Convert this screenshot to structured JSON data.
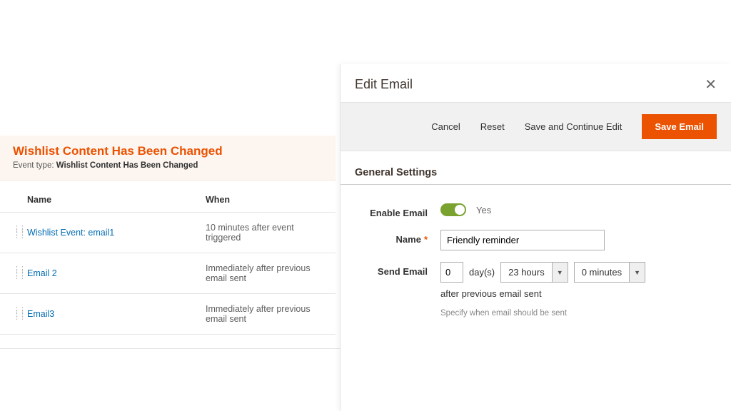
{
  "section": {
    "title": "Wishlist Content Has Been Changed",
    "event_type_label": "Event type:",
    "event_type_value": "Wishlist Content Has Been Changed"
  },
  "columns": {
    "name": "Name",
    "when": "When"
  },
  "rows": [
    {
      "name": "Wishlist Event: email1",
      "when": "10 minutes after event triggered"
    },
    {
      "name": "Email 2",
      "when": "Immediately after previous email sent"
    },
    {
      "name": "Email3",
      "when": "Immediately after previous email sent"
    }
  ],
  "modal": {
    "title": "Edit Email",
    "actions": {
      "cancel": "Cancel",
      "reset": "Reset",
      "save_continue": "Save and Continue Edit",
      "save": "Save Email"
    },
    "general_settings": "General Settings",
    "fields": {
      "enable_email_label": "Enable Email",
      "enable_email_value": "Yes",
      "name_label": "Name",
      "name_value": "Friendly reminder",
      "send_email_label": "Send Email",
      "days_value": "0",
      "days_unit": "day(s)",
      "hours_value": "23 hours",
      "minutes_value": "0 minutes",
      "after_text": "after previous email sent",
      "help_text": "Specify when email should be sent"
    }
  }
}
